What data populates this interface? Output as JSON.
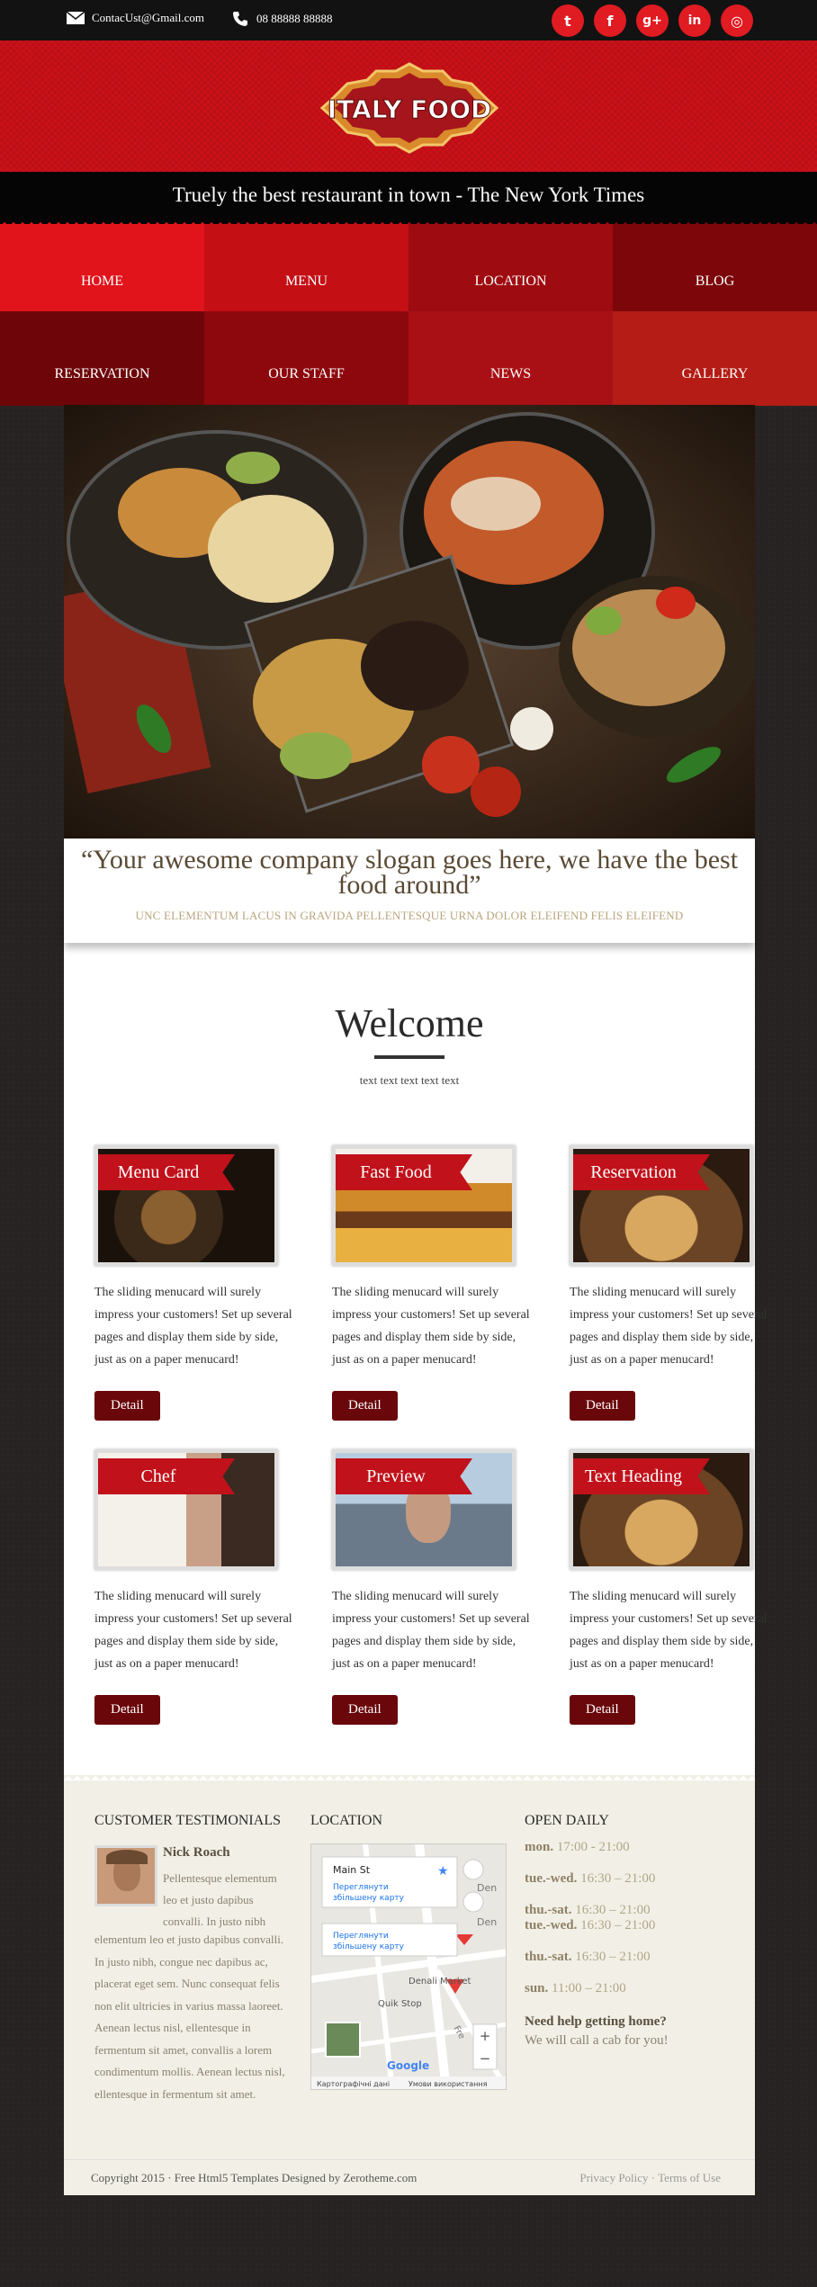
{
  "topbar": {
    "email": "ContacUst@Gmail.com",
    "phone": "08 88888 88888",
    "socials": [
      {
        "icon": "twitter-icon",
        "glyph": "t"
      },
      {
        "icon": "facebook-icon",
        "glyph": "f"
      },
      {
        "icon": "google-plus-icon",
        "glyph": "g+"
      },
      {
        "icon": "linkedin-icon",
        "glyph": "in"
      },
      {
        "icon": "instagram-icon",
        "glyph": "◎"
      }
    ]
  },
  "header": {
    "logo_text": "ITALY FOOD",
    "tagline": "Truely the best restaurant in town - The New York Times"
  },
  "nav": [
    {
      "label": "HOME",
      "color": "#e1131b"
    },
    {
      "label": "MENU",
      "color": "#c40f15"
    },
    {
      "label": "LOCATION",
      "color": "#9e0b10"
    },
    {
      "label": "BLOG",
      "color": "#7c0609"
    },
    {
      "label": "RESERVATION",
      "color": "#6e0508"
    },
    {
      "label": "OUR STAFF",
      "color": "#8d080d"
    },
    {
      "label": "NEWS",
      "color": "#a91015"
    },
    {
      "label": "GALLERY",
      "color": "#b51c15"
    }
  ],
  "slogan": {
    "text": "“Your awesome company slogan goes here, we have the best food around”",
    "sub": "UNC ELEMENTUM LACUS IN GRAVIDA PELLENTESQUE URNA DOLOR ELEIFEND FELIS ELEIFEND"
  },
  "welcome": {
    "title": "Welcome",
    "sub": "text text text text text"
  },
  "cards": [
    {
      "title": "Menu Card",
      "text": "The sliding menucard will surely impress your customers! Set up several pages and display them side by side, just as on a paper menucard!",
      "button": "Detail",
      "tone": "#4a3020"
    },
    {
      "title": "Fast Food",
      "text": "The sliding menucard will surely impress your customers! Set up several pages and display them side by side, just as on a paper menucard!",
      "button": "Detail",
      "tone": "#b06a2a"
    },
    {
      "title": "Reservation",
      "text": "The sliding menucard will surely impress your customers! Set up several pages and display them side by side, just as on a paper menucard!",
      "button": "Detail",
      "tone": "#7a5a3a"
    },
    {
      "title": "Chef",
      "text": "The sliding menucard will surely impress your customers! Set up several pages and display them side by side, just as on a paper menucard!",
      "button": "Detail",
      "tone": "#c8b8a8"
    },
    {
      "title": "Preview",
      "text": "The sliding menucard will surely impress your customers! Set up several pages and display them side by side, just as on a paper menucard!",
      "button": "Detail",
      "tone": "#8aa4c0"
    },
    {
      "title": "Text Heading",
      "text": "The sliding menucard will surely impress your customers! Set up several pages and display them side by side, just as on a paper menucard!",
      "button": "Detail",
      "tone": "#6a4a2a"
    }
  ],
  "testimonials": {
    "heading": "CUSTOMER TESTIMONIALS",
    "name": "Nick Roach",
    "text1": "Pellentesque elementum leo et justo dapibus convalli. In justo nibh",
    "text2": "elementum leo et justo dapibus convalli. In justo nibh, congue nec dapibus ac, placerat eget sem. Nunc consequat felis non elit ultricies in varius massa laoreet. Aenean lectus nisl, ellentesque in fermentum sit amet, convallis a lorem condimentum mollis. Aenean lectus nisl, ellentesque in fermentum sit amet."
  },
  "location": {
    "heading": "LOCATION",
    "map": {
      "place": "Main St",
      "link": "Переглянути збільшену карту",
      "label_market": "Denali Market",
      "label_stop": "Quik Stop",
      "label_den1": "Den",
      "label_den2": "Den",
      "label_fre": "Fre",
      "zoom_in": "+",
      "zoom_out": "−",
      "footer_data": "Картографічні дані",
      "footer_terms": "Умови використання",
      "google": "Google"
    }
  },
  "hours": {
    "heading": "OPEN DAILY",
    "lines": [
      {
        "day": "mon.",
        "time": "17:00 - 21:00"
      },
      {
        "day": "tue.-wed.",
        "time": "16:30 – 21:00"
      },
      {
        "day": "thu.-sat.",
        "time": "16:30 – 21:00"
      },
      {
        "day": "tue.-wed.",
        "time": "16:30 – 21:00"
      },
      {
        "day": "thu.-sat.",
        "time": "16:30 – 21:00"
      },
      {
        "day": "sun.",
        "time": "11:00 – 21:00"
      }
    ],
    "help": "Need help getting home?",
    "cab": "We will call a cab for you!"
  },
  "footer": {
    "copyright": "Copyright 2015 · Free Html5 Templates Designed by Zerotheme.com",
    "links": "Privacy Policy · Terms of Use"
  }
}
